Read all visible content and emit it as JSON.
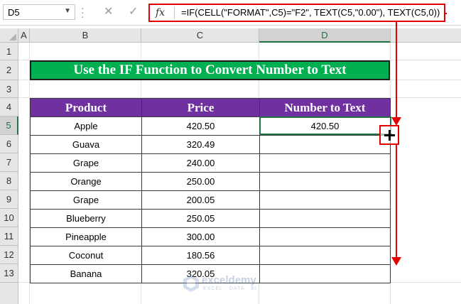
{
  "formula_bar": {
    "name_box": "D5",
    "fx_label": "fx",
    "formula": "=IF(CELL(\"FORMAT\",C5)=\"F2\", TEXT(C5,\"0.00\"), TEXT(C5,0))"
  },
  "columns": [
    "A",
    "B",
    "C",
    "D"
  ],
  "rows": [
    "1",
    "2",
    "3",
    "4",
    "5",
    "6",
    "7",
    "8",
    "9",
    "10",
    "11",
    "12",
    "13"
  ],
  "active_cell": {
    "column": "D",
    "row": "5"
  },
  "title": "Use the IF Function to Convert Number to Text",
  "table": {
    "headers": [
      "Product",
      "Price",
      "Number to Text"
    ],
    "rows": [
      {
        "product": "Apple",
        "price": "420.50",
        "text": "420.50"
      },
      {
        "product": "Guava",
        "price": "320.49",
        "text": ""
      },
      {
        "product": "Grape",
        "price": "240.00",
        "text": ""
      },
      {
        "product": "Orange",
        "price": "250.00",
        "text": ""
      },
      {
        "product": "Grape",
        "price": "200.05",
        "text": ""
      },
      {
        "product": "Blueberry",
        "price": "250.05",
        "text": ""
      },
      {
        "product": "Pineapple",
        "price": "300.00",
        "text": ""
      },
      {
        "product": "Coconut",
        "price": "180.56",
        "text": ""
      },
      {
        "product": "Banana",
        "price": "320.05",
        "text": ""
      }
    ]
  },
  "watermark": {
    "name": "exceldemy",
    "tagline": "EXCEL · DATA · BI"
  },
  "colors": {
    "title_bg": "#00b050",
    "header_bg": "#7030a0",
    "annotation": "#e60000",
    "selection": "#217346"
  }
}
